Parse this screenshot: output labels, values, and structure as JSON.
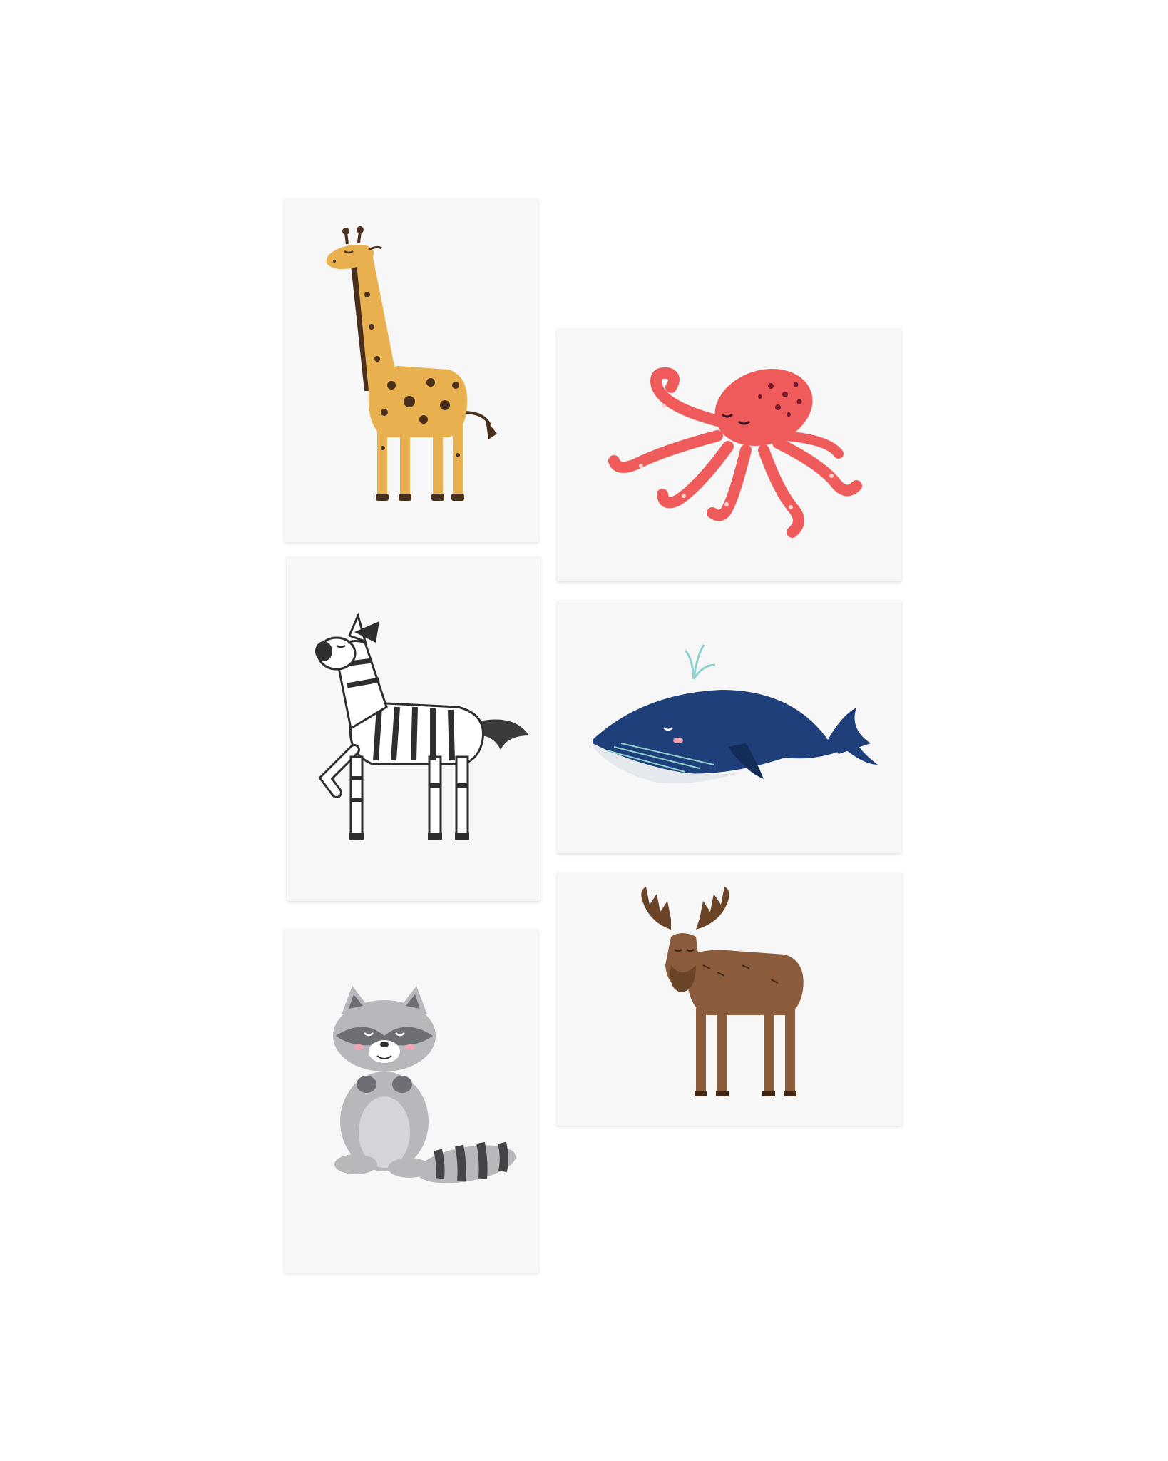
{
  "scene": {
    "background_color": "#ffffff",
    "card_color": "#f7f7f7",
    "cards": [
      {
        "id": "giraffe",
        "subject": "giraffe-illustration",
        "colors": {
          "body": "#e8b04f",
          "spots": "#4a2f1d",
          "mane": "#4a2f1d"
        }
      },
      {
        "id": "octopus",
        "subject": "octopus-illustration",
        "colors": {
          "body": "#ef5b5b",
          "spots": "#7a1830",
          "suckers": "#ffd0d0"
        }
      },
      {
        "id": "zebra",
        "subject": "zebra-illustration",
        "colors": {
          "body": "#ffffff",
          "stripes": "#2e2e2e",
          "tail": "#3b3b3b"
        }
      },
      {
        "id": "whale",
        "subject": "whale-illustration",
        "colors": {
          "body": "#1f3f7a",
          "belly": "#e5e8ec",
          "grooves": "#8fd0cf",
          "cheek": "#f2a6b6"
        }
      },
      {
        "id": "raccoon",
        "subject": "raccoon-illustration",
        "colors": {
          "body": "#b7b8bc",
          "mask": "#6e6f74",
          "tail_rings": "#444548",
          "cheek": "#f2a6b6"
        }
      },
      {
        "id": "moose",
        "subject": "moose-illustration",
        "colors": {
          "body": "#8a5c3c",
          "antlers": "#6b4427",
          "outline": "#3f2817"
        }
      }
    ]
  }
}
